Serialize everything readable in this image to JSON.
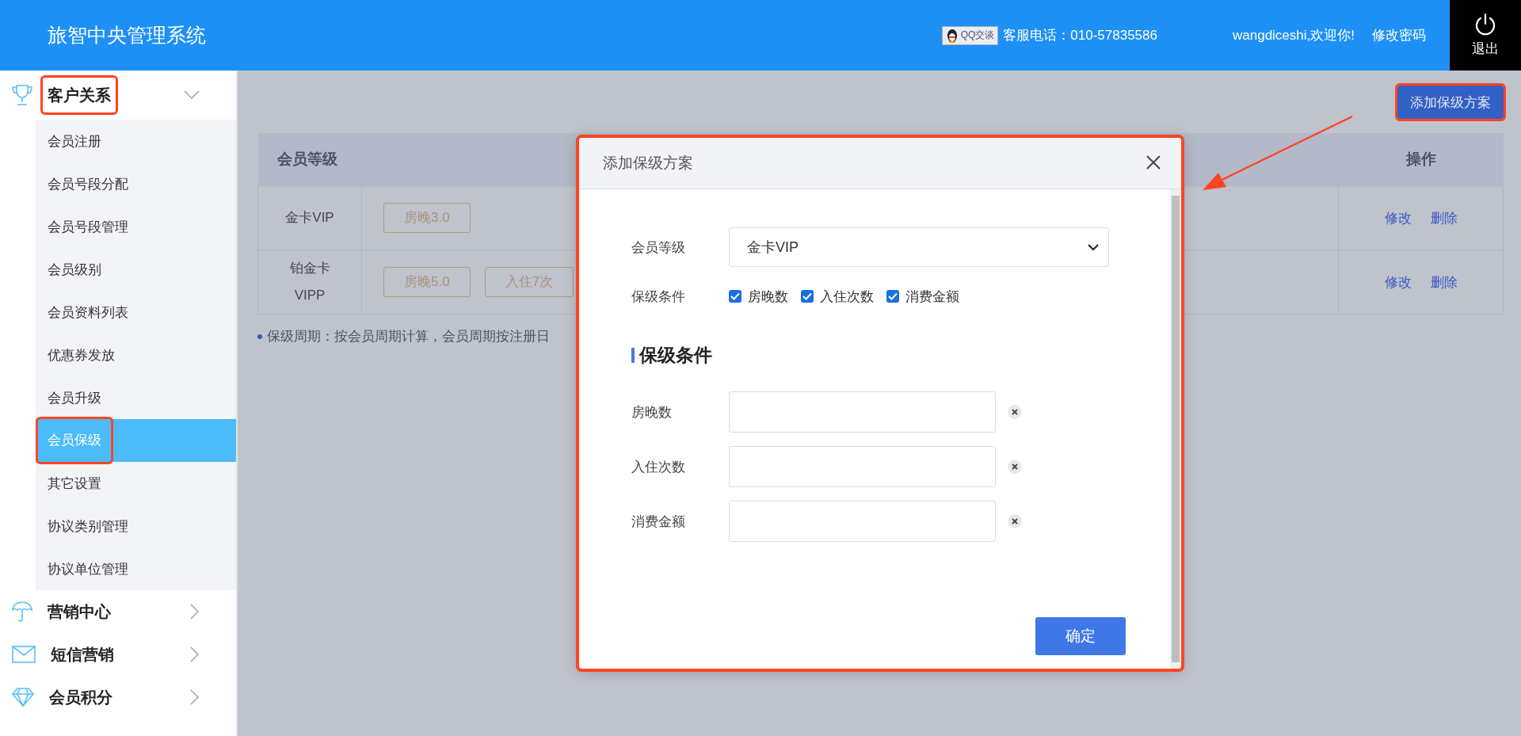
{
  "header": {
    "title": "旅智中央管理系统",
    "qq_badge": "QQ交谈",
    "hotline": "客服电话：010-57835586",
    "welcome": "wangdiceshi,欢迎你!",
    "change_password": "修改密码",
    "logout": "退出"
  },
  "sidebar": {
    "items": [
      {
        "label": "客户关系",
        "expanded": true,
        "children": [
          {
            "label": "会员注册",
            "selected": false
          },
          {
            "label": "会员号段分配",
            "selected": false
          },
          {
            "label": "会员号段管理",
            "selected": false
          },
          {
            "label": "会员级别",
            "selected": false
          },
          {
            "label": "会员资料列表",
            "selected": false
          },
          {
            "label": "优惠券发放",
            "selected": false
          },
          {
            "label": "会员升级",
            "selected": false
          },
          {
            "label": "会员保级",
            "selected": true
          },
          {
            "label": "其它设置",
            "selected": false
          },
          {
            "label": "协议类别管理",
            "selected": false
          },
          {
            "label": "协议单位管理",
            "selected": false
          }
        ]
      },
      {
        "label": "营销中心",
        "expanded": false
      },
      {
        "label": "短信营销",
        "expanded": false
      },
      {
        "label": "会员积分",
        "expanded": false
      }
    ]
  },
  "add_button": "添加保级方案",
  "table": {
    "columns": [
      "会员等级",
      "操作"
    ],
    "rows": [
      {
        "level": "金卡VIP",
        "conditions": [
          "房晚3.0"
        ],
        "actions": [
          "修改",
          "删除"
        ]
      },
      {
        "level": "铂金卡VIPP",
        "conditions": [
          "房晚5.0",
          "入住7次"
        ],
        "actions": [
          "修改",
          "删除"
        ]
      }
    ]
  },
  "note": "保级周期：按会员周期计算，会员周期按注册日",
  "dialog": {
    "title": "添加保级方案",
    "member_level": {
      "label": "会员等级",
      "value": "金卡VIP"
    },
    "conditions": {
      "label": "保级条件",
      "options": [
        {
          "label": "房晚数",
          "checked": true
        },
        {
          "label": "入住次数",
          "checked": true
        },
        {
          "label": "消费金额",
          "checked": true
        }
      ]
    },
    "section_title": "保级条件",
    "fields": [
      {
        "label": "房晚数"
      },
      {
        "label": "入住次数"
      },
      {
        "label": "消费金额"
      }
    ],
    "confirm": "确定"
  }
}
